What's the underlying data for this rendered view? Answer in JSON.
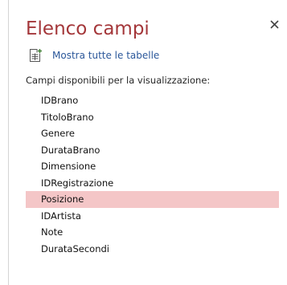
{
  "panel": {
    "title": "Elenco campi",
    "close_icon": "close-icon",
    "show_all_tables": {
      "icon": "table-add-icon",
      "label": "Mostra tutte le tabelle"
    },
    "available_fields_label": "Campi disponibili per la visualizzazione:",
    "fields": [
      {
        "label": "IDBrano",
        "selected": false
      },
      {
        "label": "TitoloBrano",
        "selected": false
      },
      {
        "label": "Genere",
        "selected": false
      },
      {
        "label": "DurataBrano",
        "selected": false
      },
      {
        "label": "Dimensione",
        "selected": false
      },
      {
        "label": "IDRegistrazione",
        "selected": false
      },
      {
        "label": "Posizione",
        "selected": true
      },
      {
        "label": "IDArtista",
        "selected": false
      },
      {
        "label": "Note",
        "selected": false
      },
      {
        "label": "DurataSecondi",
        "selected": false
      }
    ]
  },
  "colors": {
    "title": "#a4373a",
    "link": "#2b579a",
    "selected_row": "#f4c6c7"
  }
}
